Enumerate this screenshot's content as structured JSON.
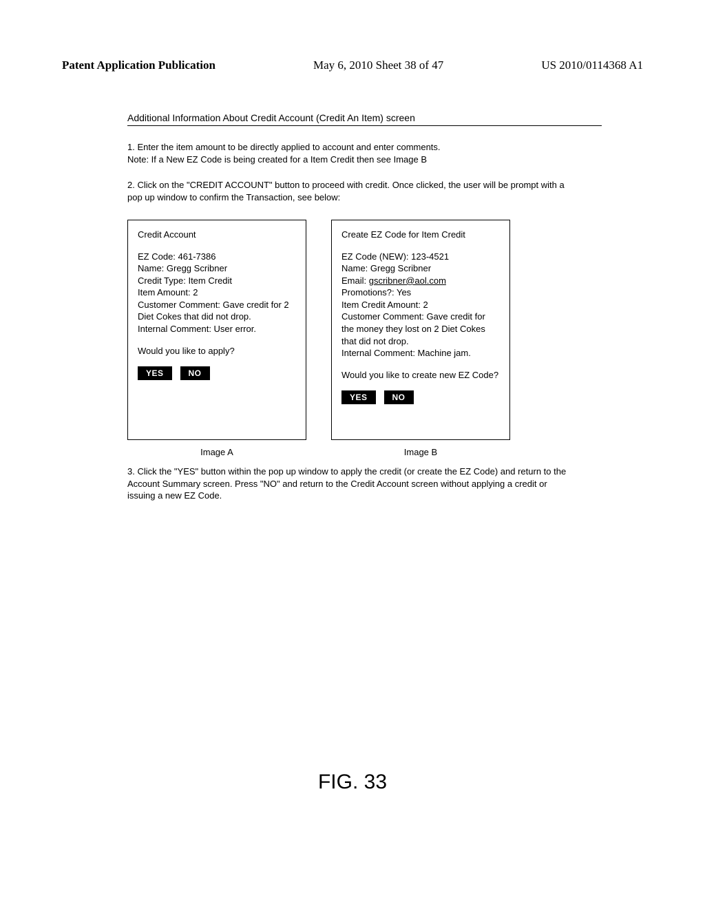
{
  "header": {
    "left": "Patent Application Publication",
    "center": "May 6, 2010  Sheet 38 of 47",
    "right": "US 2010/0114368 A1"
  },
  "section": {
    "title": "Additional Information About Credit Account (Credit An Item) screen"
  },
  "steps": {
    "s1a": "1. Enter the item amount to be directly applied to account and enter comments.",
    "s1b": "Note: If a New EZ Code is being created for a Item Credit then see Image B",
    "s2": "2. Click on the \"CREDIT ACCOUNT\" button to proceed with credit.  Once clicked, the user will be prompt with a pop up window to confirm the Transaction, see below:",
    "s3": "3.  Click the \"YES\" button within the pop up window to apply the credit (or create the EZ Code) and return to the Account Summary screen.  Press \"NO\" and return to the Credit Account screen without applying a credit or issuing a new EZ Code."
  },
  "dialogA": {
    "title": "Credit Account",
    "lines": {
      "ez": "EZ Code: 461-7386",
      "name": "Name: Gregg Scribner",
      "ctype": "Credit Type: Item Credit",
      "amount": "Item Amount: 2",
      "cust": "Customer Comment: Gave credit for 2 Diet Cokes that did not drop.",
      "internal": "Internal Comment: User error."
    },
    "prompt": "Would you like to apply?",
    "yes": "YES",
    "no": "NO",
    "caption": "Image A"
  },
  "dialogB": {
    "title": "Create EZ Code for Item Credit",
    "lines": {
      "ez": "EZ Code (NEW): 123-4521",
      "name": "Name: Gregg Scribner",
      "email_label": "Email: ",
      "email_value": "gscribner@aol.com",
      "promo": "Promotions?: Yes",
      "amount": "Item Credit Amount: 2",
      "cust": "Customer Comment: Gave credit for the money they lost on 2 Diet Cokes that did not drop.",
      "internal": "Internal Comment: Machine jam."
    },
    "prompt": "Would you like to create new EZ Code?",
    "yes": "YES",
    "no": "NO",
    "caption": "Image B"
  },
  "figure": {
    "label": "FIG. 33"
  }
}
